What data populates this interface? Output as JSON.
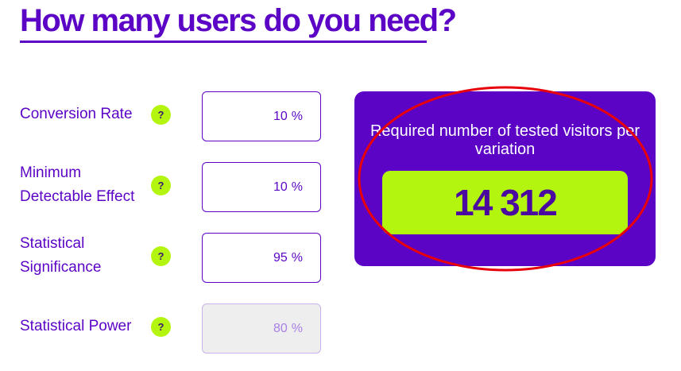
{
  "header": {
    "title": "How many users do you need?"
  },
  "form": {
    "rows": [
      {
        "label": "Conversion Rate",
        "help": "?",
        "value": "10",
        "unit": "%",
        "enabled": true
      },
      {
        "label": "Minimum Detectable Effect",
        "help": "?",
        "value": "10",
        "unit": "%",
        "enabled": true
      },
      {
        "label": "Statistical Significance",
        "help": "?",
        "value": "95",
        "unit": "%",
        "enabled": true
      },
      {
        "label": "Statistical Power",
        "help": "?",
        "value": "80",
        "unit": "%",
        "enabled": false
      }
    ]
  },
  "result": {
    "label": "Required number of tested visitors per variation",
    "value": "14 312"
  },
  "colors": {
    "brand_purple": "#5b04c6",
    "accent_lime": "#b4f510",
    "annotation_red": "#e8000b",
    "disabled_bg": "#eeeeee"
  },
  "icons": {
    "help": "help-icon"
  }
}
